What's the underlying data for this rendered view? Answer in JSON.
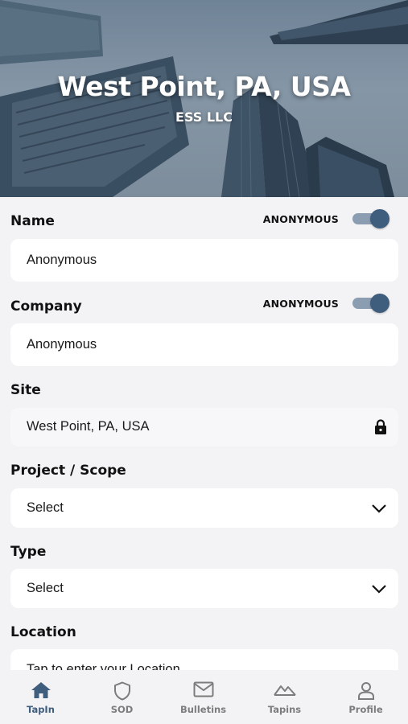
{
  "header": {
    "title": "West Point, PA, USA",
    "subtitle": "ESS LLC"
  },
  "form": {
    "name": {
      "label": "Name",
      "anonymous_label": "ANONYMOUS",
      "anonymous_on": true,
      "value": "Anonymous"
    },
    "company": {
      "label": "Company",
      "anonymous_label": "ANONYMOUS",
      "anonymous_on": true,
      "value": "Anonymous"
    },
    "site": {
      "label": "Site",
      "value": "West Point, PA, USA",
      "icon": "lock-icon"
    },
    "project": {
      "label": "Project / Scope",
      "value": "Select",
      "icon": "chevron-down-icon"
    },
    "type": {
      "label": "Type",
      "value": "Select",
      "icon": "chevron-down-icon"
    },
    "location": {
      "label": "Location",
      "placeholder": "Tap to enter your Location"
    }
  },
  "tabbar": {
    "active": "TapIn",
    "tabs": [
      {
        "label": "TapIn",
        "icon": "home-icon"
      },
      {
        "label": "SOD",
        "icon": "shield-icon"
      },
      {
        "label": "Bulletins",
        "icon": "mail-icon"
      },
      {
        "label": "Tapins",
        "icon": "mountain-icon"
      },
      {
        "label": "Profile",
        "icon": "person-icon"
      }
    ]
  },
  "colors": {
    "accent": "#3f5d7d",
    "toggle_track": "#8b9eb1",
    "background": "#f3f3f6",
    "inactive_tab": "#7c7c7c"
  }
}
